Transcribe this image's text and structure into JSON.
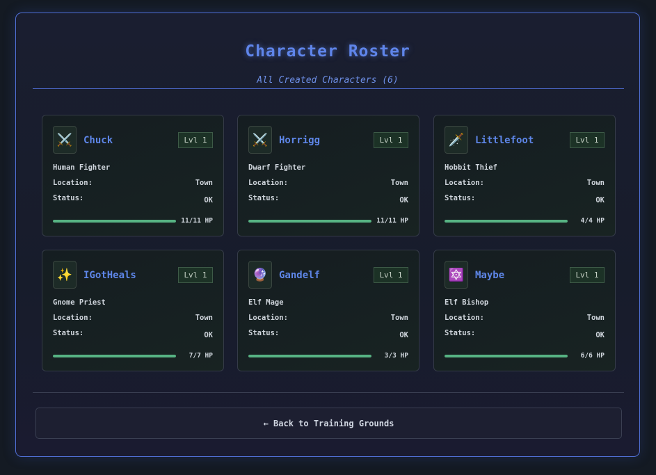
{
  "header": {
    "title": "Character Roster",
    "subtitle": "All Created Characters (6)"
  },
  "characters": [
    {
      "name": "Chuck",
      "icon": "crossed-swords-icon",
      "glyph": "⚔️",
      "level": "Lvl 1",
      "race_class": "Human Fighter",
      "location_label": "Location:",
      "location": "Town",
      "status_label": "Status:",
      "status": "OK",
      "hp_current": 11,
      "hp_max": 11,
      "hp_text": "11/11 HP"
    },
    {
      "name": "Horrigg",
      "icon": "crossed-swords-icon",
      "glyph": "⚔️",
      "level": "Lvl 1",
      "race_class": "Dwarf Fighter",
      "location_label": "Location:",
      "location": "Town",
      "status_label": "Status:",
      "status": "OK",
      "hp_current": 11,
      "hp_max": 11,
      "hp_text": "11/11 HP"
    },
    {
      "name": "Littlefoot",
      "icon": "dagger-icon",
      "glyph": "🗡️",
      "level": "Lvl 1",
      "race_class": "Hobbit Thief",
      "location_label": "Location:",
      "location": "Town",
      "status_label": "Status:",
      "status": "OK",
      "hp_current": 4,
      "hp_max": 4,
      "hp_text": "4/4 HP"
    },
    {
      "name": "IGotHeals",
      "icon": "sparkles-icon",
      "glyph": "✨",
      "level": "Lvl 1",
      "race_class": "Gnome Priest",
      "location_label": "Location:",
      "location": "Town",
      "status_label": "Status:",
      "status": "OK",
      "hp_current": 7,
      "hp_max": 7,
      "hp_text": "7/7 HP"
    },
    {
      "name": "Gandelf",
      "icon": "crystal-ball-icon",
      "glyph": "🔮",
      "level": "Lvl 1",
      "race_class": "Elf Mage",
      "location_label": "Location:",
      "location": "Town",
      "status_label": "Status:",
      "status": "OK",
      "hp_current": 3,
      "hp_max": 3,
      "hp_text": "3/3 HP"
    },
    {
      "name": "Maybe",
      "icon": "star-of-david-icon",
      "glyph": "🔯",
      "level": "Lvl 1",
      "race_class": "Elf Bishop",
      "location_label": "Location:",
      "location": "Town",
      "status_label": "Status:",
      "status": "OK",
      "hp_current": 6,
      "hp_max": 6,
      "hp_text": "6/6 HP"
    }
  ],
  "footer": {
    "back_label": "← Back to Training Grounds"
  },
  "colors": {
    "accent": "#5f85ea",
    "hp_bar": "#57b383",
    "panel_border": "#5070d6"
  }
}
